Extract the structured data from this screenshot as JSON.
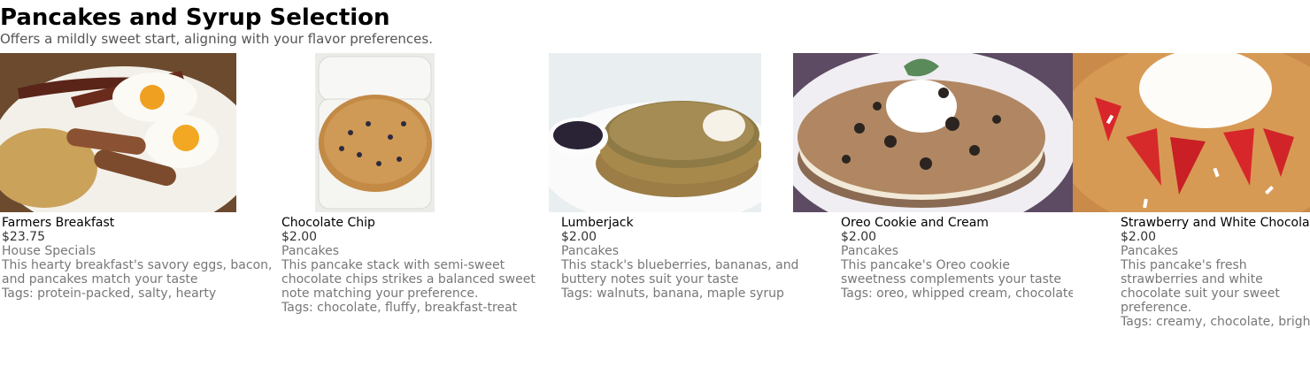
{
  "header": {
    "title": "Pancakes and Syrup Selection",
    "subtitle": "Offers a mildly sweet start, aligning with your flavor preferences."
  },
  "items": [
    {
      "name": "Farmers Breakfast",
      "price": "$23.75",
      "category": "House Specials",
      "description": "This hearty breakfast's savory eggs, bacon, and pancakes match your taste",
      "tags": "Tags: protein-packed, salty, hearty",
      "photo": "farmers-breakfast-photo"
    },
    {
      "name": "Chocolate Chip",
      "price": "$2.00",
      "category": "Pancakes",
      "description": "This pancake stack with semi-sweet chocolate chips strikes a balanced sweet note matching your preference.",
      "tags": "Tags: chocolate, fluffy, breakfast-treat",
      "photo": "chocolate-chip-pancake-photo"
    },
    {
      "name": "Lumberjack",
      "price": "$2.00",
      "category": "Pancakes",
      "description": "This stack's blueberries, bananas, and buttery notes suit your taste",
      "tags": "Tags: walnuts, banana, maple syrup",
      "photo": "lumberjack-pancake-photo"
    },
    {
      "name": "Oreo Cookie and Cream",
      "price": "$2.00",
      "category": "Pancakes",
      "description": "This pancake's Oreo cookie sweetness complements your taste",
      "tags": "Tags: oreo, whipped cream, chocolate",
      "photo": "oreo-pancake-photo"
    },
    {
      "name": "Strawberry and White Chocolate",
      "price": "$2.00",
      "category": "Pancakes",
      "description": "This pancake's fresh strawberries and white chocolate suit your sweet preference.",
      "tags": "Tags: creamy, chocolate, bright",
      "photo": "strawberry-white-chocolate-pancake-photo"
    }
  ]
}
